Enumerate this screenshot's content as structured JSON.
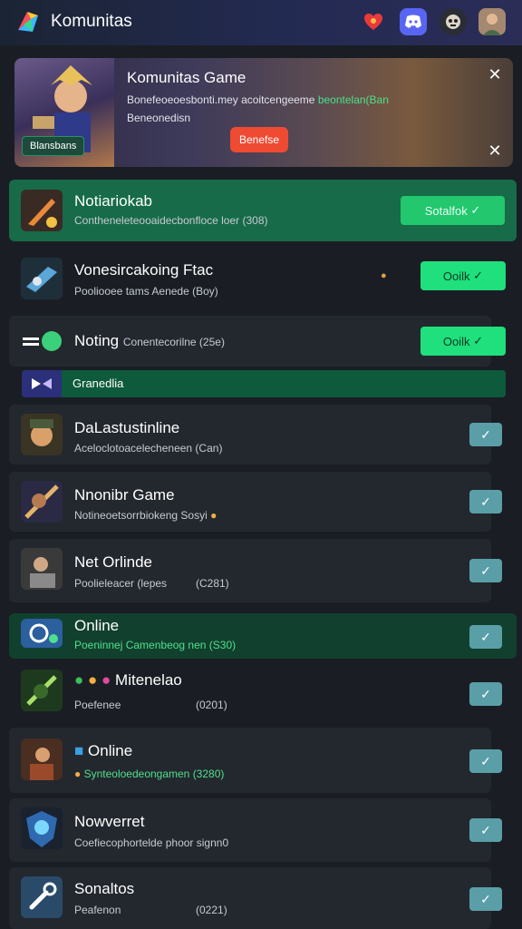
{
  "header": {
    "title": "Komunitas"
  },
  "banner": {
    "title": "Komunitas Game",
    "desc_line1": "Bonefeoeoesbonti.mey acoitcengeeme",
    "desc_line1_hl": "beontelan(Ban",
    "desc_line2": "Beneonedisn",
    "badge": "Blansbans",
    "button": "Benefse"
  },
  "rows": [
    {
      "title": "Notiariokab",
      "sub": "Contheneleteooaidecbonfloce loer (308)",
      "button": "Sotalfok",
      "style": "green"
    },
    {
      "title": "Vonesircakoing Ftac",
      "sub": "Pooliooee tams Aenede (Boy)",
      "button": "Ooilk",
      "style": "plain"
    },
    {
      "title": "Noting",
      "sub": "Conentecorilne (25e)",
      "button": "Ooilk",
      "style": "plain"
    },
    {
      "title": "DaLastustinline",
      "sub": "Aceloclotoacelecheneen (Can)",
      "style": "plain"
    },
    {
      "title": "Nnonibr Game",
      "sub": "Notineoetsorrbiokeng Sosyi",
      "style": "plain"
    },
    {
      "title": "Net Orlinde",
      "sub": "Poolieleacer (lepes",
      "sub2": "(C281)",
      "style": "plain"
    },
    {
      "title": "Online",
      "sub": "Poeninnej Camenbeog nen (S30)",
      "style": "greendark"
    },
    {
      "title": "Mitenelao",
      "sub": "Poefenee",
      "sub2": "(0201)",
      "style": "plain"
    },
    {
      "title": "Online",
      "sub": "Synteoloedeongamen (3280)",
      "style": "plain"
    },
    {
      "title": "Nowverret",
      "sub": "Coefiecophortelde phoor signn0",
      "style": "plain"
    },
    {
      "title": "Sonaltos",
      "sub": "Peafenon",
      "sub2": "(0221)",
      "style": "plain"
    }
  ],
  "section": {
    "label": "Granedlia"
  },
  "colors": {
    "accent_green": "#1fe07c",
    "highlight_row": "#176b48",
    "banner_button": "#ef4b33",
    "small_check": "#5a9fa8"
  }
}
